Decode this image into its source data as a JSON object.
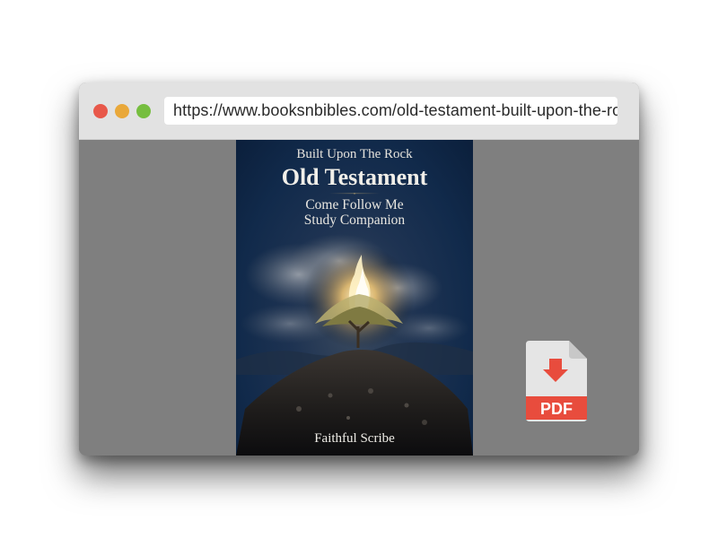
{
  "browser": {
    "url": "https://www.booksnbibles.com/old-testament-built-upon-the-rock"
  },
  "cover": {
    "subtitle": "Built Upon The Rock",
    "title": "Old Testament",
    "line1": "Come Follow Me",
    "line2": "Study Companion",
    "author": "Faithful Scribe"
  },
  "pdf_icon": {
    "label": "PDF",
    "icon": "pdf-download-icon"
  },
  "colors": {
    "close": "#e8584a",
    "minimize": "#e9a83a",
    "maximize": "#76be3f",
    "pdf_accent": "#e84c3d",
    "pdf_page": "#e5e5e5",
    "pdf_fold": "#c8c8c8",
    "content_bg": "#7f7f7f"
  }
}
